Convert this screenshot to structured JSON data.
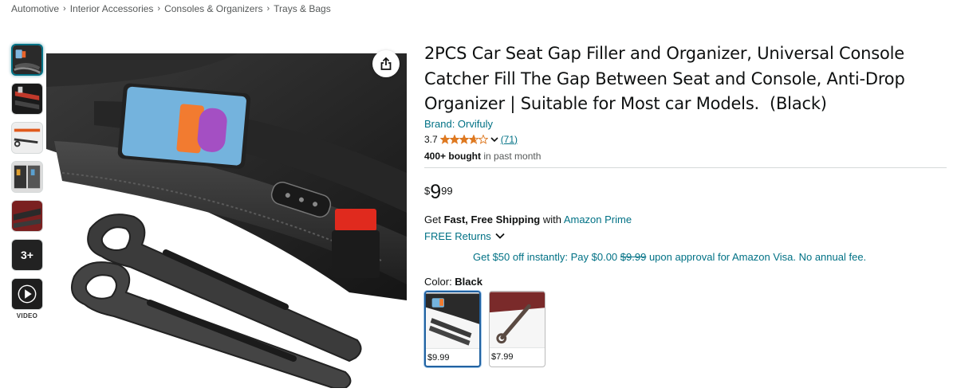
{
  "breadcrumb": [
    "Automotive",
    "Interior Accessories",
    "Consoles & Organizers",
    "Trays & Bags"
  ],
  "gallery": {
    "thumb_count": 7,
    "more_label": "3+",
    "video_label": "VIDEO"
  },
  "product": {
    "title": "2PCS Car Seat Gap Filler and Organizer, Universal Console Catcher Fill The Gap Between Seat and Console, Anti-Drop Organizer | Suitable for Most car Models.  (Black)",
    "brand": "Brand: Orvifuly",
    "rating": "3.7",
    "rating_value": 3.7,
    "rating_count": "(71)",
    "bought_bold": "400+ bought",
    "bought_rest": " in past month"
  },
  "price": {
    "symbol": "$",
    "whole": "9",
    "fraction": "99"
  },
  "shipping": {
    "get": "Get ",
    "bold": "Fast, Free Shipping",
    "with": " with ",
    "prime": "Amazon Prime",
    "returns": "FREE Returns"
  },
  "offer": {
    "prefix": "Get $50 off instantly: Pay $0.00 ",
    "strike": "$9.99",
    "suffix": " upon approval for Amazon Visa. No annual fee."
  },
  "color": {
    "label": "Color: ",
    "selected": "Black",
    "options": [
      {
        "price": "$9.99"
      },
      {
        "price": "$7.99"
      }
    ]
  },
  "colors": {
    "link": "#007185",
    "star": "#de7921",
    "selected_border": "#2162a1"
  }
}
